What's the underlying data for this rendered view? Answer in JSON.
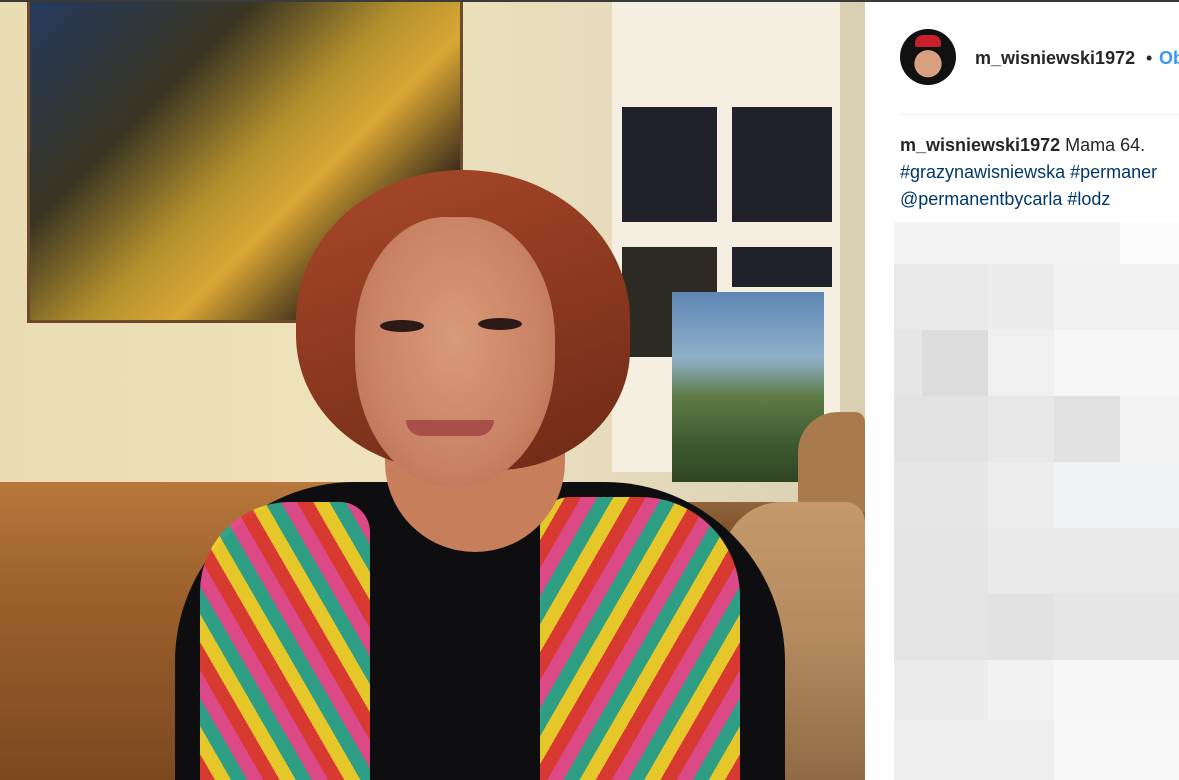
{
  "post": {
    "username": "m_wisniewski1972",
    "separator": "•",
    "follow_label": "Ob",
    "caption_user": "m_wisniewski1972",
    "caption_text": "Mama 64.",
    "hashtags_line1": [
      "#grazynawisniewska",
      "#permaner"
    ],
    "line2_mention": "@permanentbycarla",
    "line2_hashtag": "#lodz"
  },
  "colors": {
    "link": "#3897f0",
    "hashtag": "#00376b",
    "text": "#262626",
    "divider": "#efefef"
  },
  "icons": {
    "avatar": "profile-avatar"
  }
}
